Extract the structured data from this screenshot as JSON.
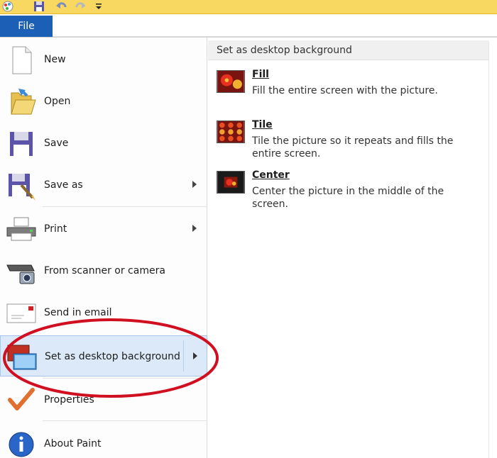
{
  "file_tab": {
    "label": "File"
  },
  "menu_items": [
    {
      "label": "New",
      "icon": "new-document-icon"
    },
    {
      "label": "Open",
      "icon": "open-folder-icon"
    },
    {
      "label": "Save",
      "icon": "save-floppy-icon"
    },
    {
      "label": "Save as",
      "icon": "save-as-icon",
      "submenu": true
    },
    {
      "label": "Print",
      "icon": "printer-icon",
      "submenu": true
    },
    {
      "label": "From scanner or camera",
      "icon": "scanner-camera-icon"
    },
    {
      "label": "Send in email",
      "icon": "email-envelope-icon"
    },
    {
      "label": "Set as desktop background",
      "icon": "desktop-background-icon",
      "submenu": true
    },
    {
      "label": "Properties",
      "icon": "properties-checkmark-icon"
    },
    {
      "label": "About Paint",
      "icon": "info-icon"
    }
  ],
  "submenu": {
    "header": "Set as desktop background",
    "options": [
      {
        "title": "Fill",
        "description": "Fill the entire screen with the picture."
      },
      {
        "title": "Tile",
        "description": "Tile the picture so it repeats and fills the entire screen."
      },
      {
        "title": "Center",
        "description": "Center the picture in the middle of the screen."
      }
    ]
  },
  "colors": {
    "file_tab": "#1b5fb6",
    "highlight": "#dbe9f8",
    "annotation": "#d01020",
    "quick_access_bar": "#f8d860"
  }
}
